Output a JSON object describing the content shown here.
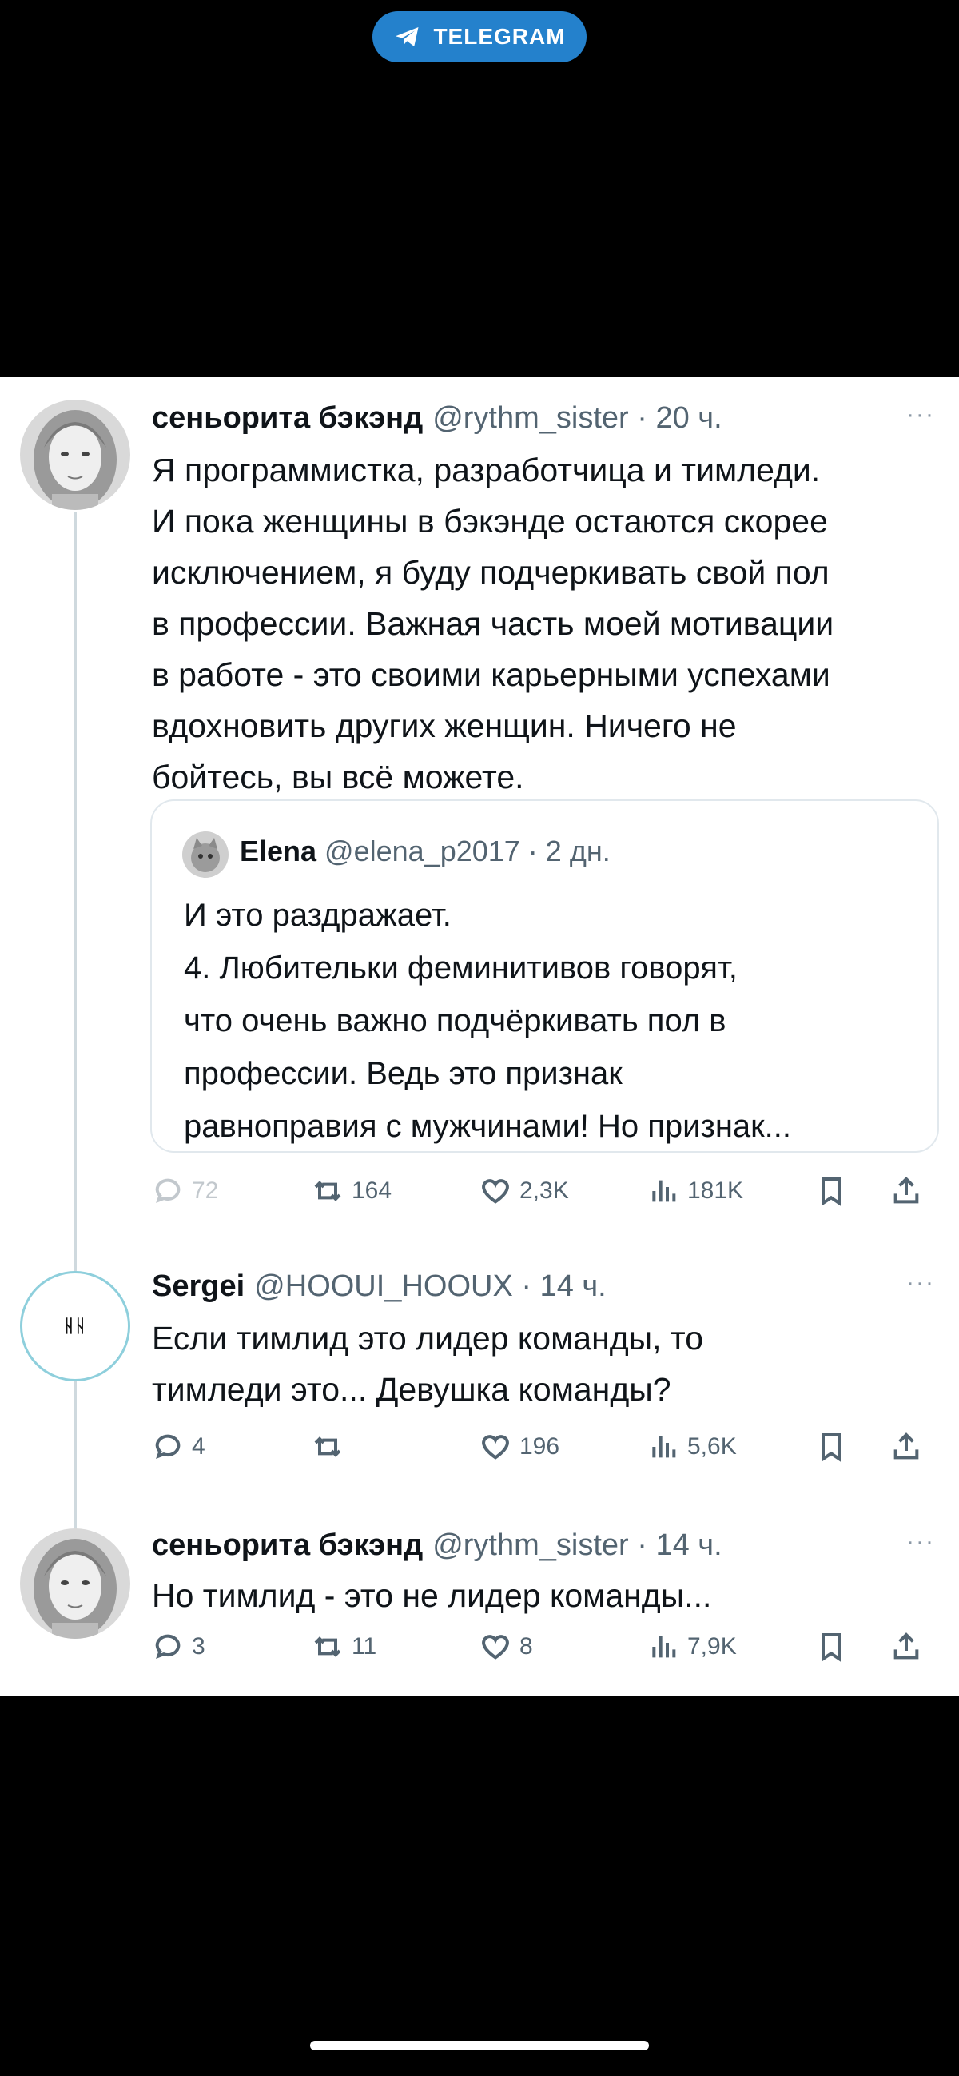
{
  "telegram_badge": {
    "label": "TELEGRAM"
  },
  "tweets": [
    {
      "name": "сеньорита бэкэнд",
      "handle": "@rythm_sister · 20 ч.",
      "more": "···",
      "lines": [
        "Я программистка, разработчица и тимледи.",
        "И пока женщины в бэкэнде остаются скорее",
        "исключением, я буду подчеркивать свой пол",
        "в профессии. Важная часть моей мотивации",
        "в работе - это своими карьерными успехами",
        "вдохновить других женщин. Ничего не",
        "бойтесь, вы всё можете."
      ],
      "quote": {
        "name": "Elena",
        "handle": "@elena_p2017 · 2 дн.",
        "lines": [
          "И это раздражает.",
          "4. Любительки феминитивов говорят,",
          "что очень важно подчёркивать пол в",
          "профессии. Ведь это признак",
          "равноправия с мужчинами! Но признак..."
        ]
      },
      "actions": {
        "replies": "72",
        "retweets": "164",
        "likes": "2,3K",
        "views": "181K"
      }
    },
    {
      "name": "Sergei",
      "handle": "@HOOUI_HOOUX · 14 ч.",
      "more": "···",
      "avatar_initials": "ᚺᚺ",
      "lines": [
        "Если тимлид это лидер команды, то",
        "тимледи это... Девушка команды?"
      ],
      "actions": {
        "replies": "4",
        "retweets": "",
        "likes": "196",
        "views": "5,6K"
      }
    },
    {
      "name": "сеньорита бэкэнд",
      "handle": "@rythm_sister · 14 ч.",
      "more": "···",
      "lines": [
        "Но тимлид - это не лидер команды..."
      ],
      "actions": {
        "replies": "3",
        "retweets": "11",
        "likes": "8",
        "views": "7,9K"
      }
    }
  ],
  "icons": {
    "reply": "reply-icon",
    "retweet": "retweet-icon",
    "like": "heart-icon",
    "views": "views-icon",
    "bookmark": "bookmark-icon",
    "share": "share-icon"
  },
  "colors": {
    "telegram": "#2481cc",
    "text": "#0f1419",
    "secondary": "#536471"
  }
}
